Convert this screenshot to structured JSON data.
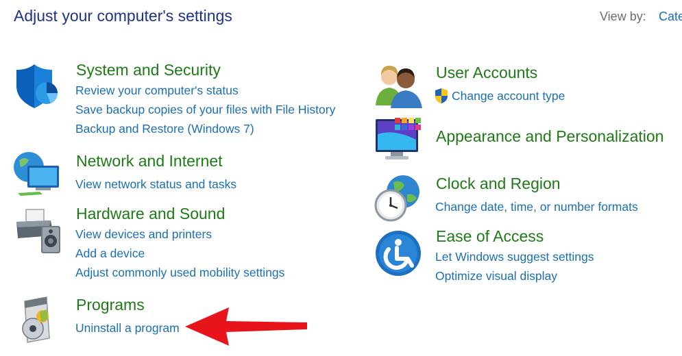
{
  "header": {
    "title": "Adjust your computer's settings",
    "view_by_label": "View by:",
    "view_by_value": "Cate"
  },
  "categories": [
    {
      "title": "System and Security",
      "icon": "shield-icon",
      "links": [
        "Review your computer's status",
        "Save backup copies of your files with File History",
        "Backup and Restore (Windows 7)"
      ]
    },
    {
      "title": "Network and Internet",
      "icon": "network-globe-icon",
      "links": [
        "View network status and tasks"
      ]
    },
    {
      "title": "Hardware and Sound",
      "icon": "printer-speaker-icon",
      "links": [
        "View devices and printers",
        "Add a device",
        "Adjust commonly used mobility settings"
      ]
    },
    {
      "title": "Programs",
      "icon": "programs-disc-icon",
      "links": [
        "Uninstall a program"
      ]
    },
    {
      "title": "User Accounts",
      "icon": "users-icon",
      "links": [
        "Change account type"
      ]
    },
    {
      "title": "Appearance and Personalization",
      "icon": "monitor-palette-icon",
      "links": []
    },
    {
      "title": "Clock and Region",
      "icon": "clock-globe-icon",
      "links": [
        "Change date, time, or number formats"
      ]
    },
    {
      "title": "Ease of Access",
      "icon": "ease-of-access-icon",
      "links": [
        "Let Windows suggest settings",
        "Optimize visual display"
      ]
    }
  ],
  "colors": {
    "title": "#1e3287",
    "category": "#1e7a16",
    "link": "#1a6fb4",
    "annotation_arrow": "#e8141c"
  }
}
